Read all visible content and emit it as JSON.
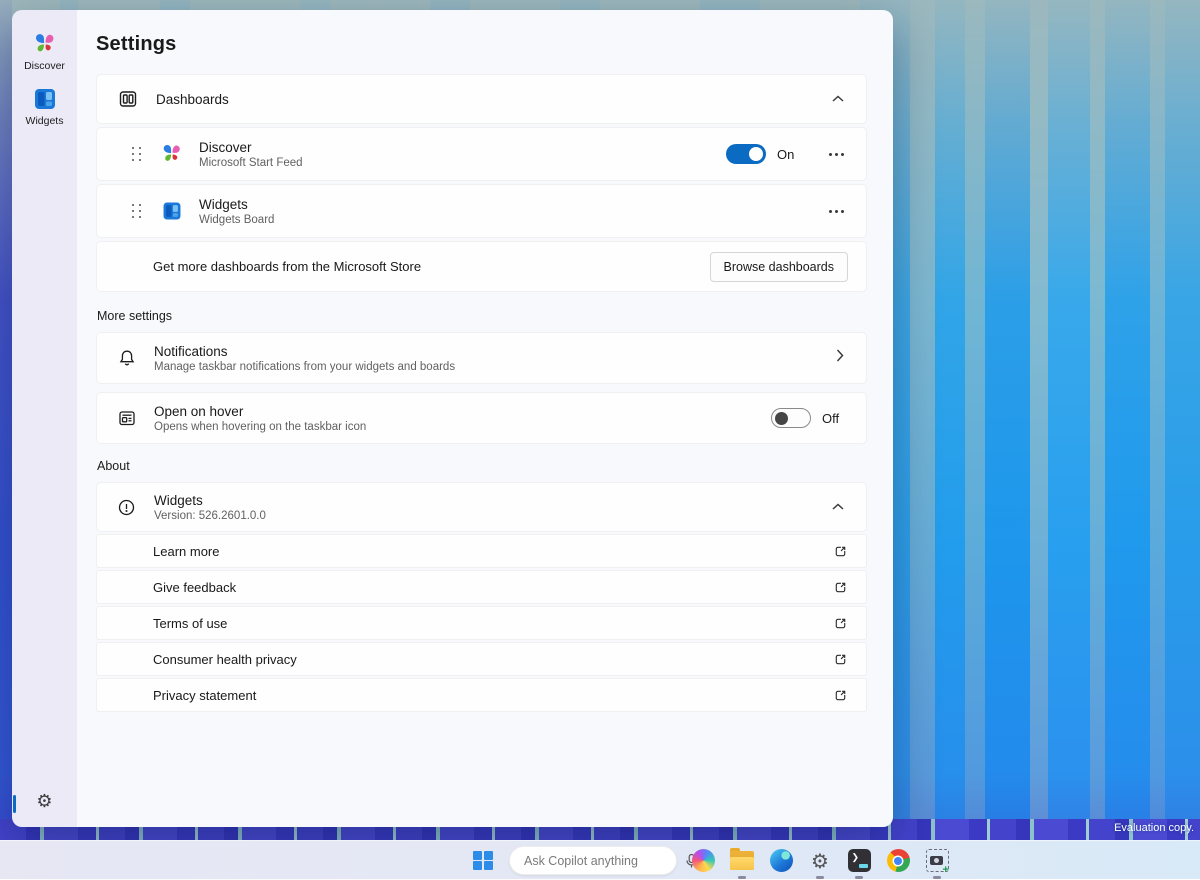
{
  "window": {
    "sidebar": {
      "items": [
        {
          "label": "Discover",
          "icon": "discover-logo-icon"
        },
        {
          "label": "Widgets",
          "icon": "widgets-logo-icon"
        }
      ],
      "settings_icon": "gear-icon",
      "settings_glyph": "⚙"
    },
    "title": "Settings",
    "dashboards": {
      "header": "Dashboards",
      "header_icon": "dashboards-icon",
      "rows": [
        {
          "title": "Discover",
          "subtitle": "Microsoft Start Feed",
          "toggle_state": "On",
          "icon": "discover-logo-icon"
        },
        {
          "title": "Widgets",
          "subtitle": "Widgets Board",
          "icon": "widgets-logo-icon"
        }
      ],
      "footer": {
        "text": "Get more dashboards from the Microsoft Store",
        "button": "Browse dashboards"
      }
    },
    "more_settings": {
      "label": "More settings",
      "notifications": {
        "title": "Notifications",
        "subtitle": "Manage taskbar notifications from your widgets and boards",
        "icon": "bell-icon"
      },
      "open_on_hover": {
        "title": "Open on hover",
        "subtitle": "Opens when hovering on the taskbar icon",
        "toggle_state": "Off",
        "icon": "board-icon"
      }
    },
    "about": {
      "label": "About",
      "header": {
        "title": "Widgets",
        "subtitle": "Version: 526.2601.0.0",
        "icon": "info-icon"
      },
      "links": [
        "Learn more",
        "Give feedback",
        "Terms of use",
        "Consumer health privacy",
        "Privacy statement"
      ]
    }
  },
  "taskbar": {
    "search_placeholder": "Ask Copilot anything",
    "icons": [
      "start-icon",
      "copilot-icon",
      "file-explorer-icon",
      "edge-icon",
      "settings-gear-icon",
      "terminal-icon",
      "chrome-icon",
      "snipping-tool-icon"
    ],
    "mic_icon": "microphone-icon"
  },
  "desktop": {
    "watermark": "Evaluation copy."
  },
  "colors": {
    "accent_toggle": "#0b6bc3",
    "taskbar": "#e3e8f5",
    "sidebar": "#eceaf7",
    "panel_bg": "#f8f9fc"
  }
}
